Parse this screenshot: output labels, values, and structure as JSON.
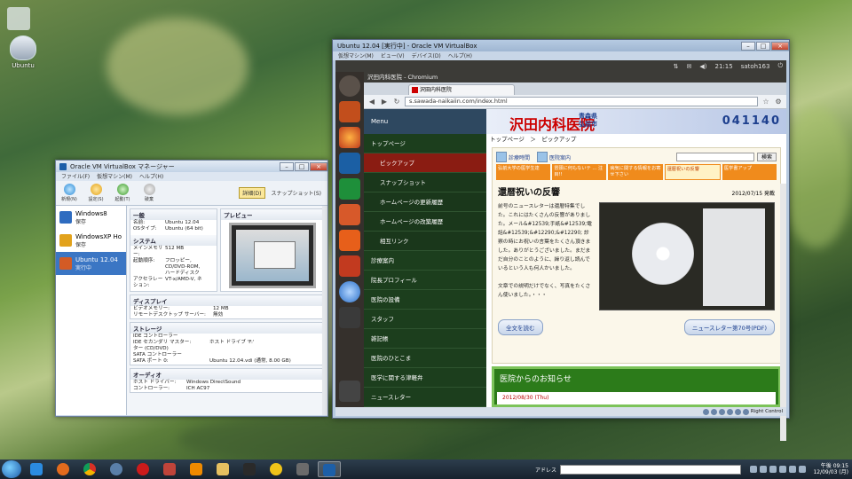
{
  "desktop": {
    "icon_label": "Ubuntu"
  },
  "vbox_manager": {
    "title": "Oracle VM VirtualBox マネージャー",
    "menu": [
      "ファイル(F)",
      "仮想マシン(M)",
      "ヘルプ(H)"
    ],
    "toolbar": {
      "new": "新規(N)",
      "settings": "設定(S)",
      "start": "起動(T)",
      "discard": "破棄",
      "details": "詳細(D)",
      "snapshots": "スナップショット(S)"
    },
    "vms": [
      {
        "name": "Windows8",
        "state": "保存",
        "color": "#2f6cc0"
      },
      {
        "name": "WindowsXP Ho",
        "state": "保存",
        "color": "#e2a21c"
      },
      {
        "name": "Ubuntu 12.04",
        "state": "実行中",
        "color": "#d35b25"
      }
    ],
    "general": {
      "header": "一般",
      "rows": [
        {
          "k": "名前:",
          "v": "Ubuntu 12.04"
        },
        {
          "k": "OSタイプ:",
          "v": "Ubuntu (64 bit)"
        }
      ]
    },
    "preview_header": "プレビュー",
    "system": {
      "header": "システム",
      "rows": [
        {
          "k": "メインメモリー:",
          "v": "512 MB"
        },
        {
          "k": "起動順序:",
          "v": "フロッピー,"
        },
        {
          "k": "",
          "v": "CD/DVD-ROM,"
        },
        {
          "k": "",
          "v": "ハードディスク"
        },
        {
          "k": "アクセラレーション:",
          "v": "VT-x/AMD-V, ネ"
        }
      ]
    },
    "display": {
      "header": "ディスプレイ",
      "rows": [
        {
          "k": "ビデオメモリー:",
          "v": "12 MB"
        },
        {
          "k": "リモートデスクトップ サーバー:",
          "v": "無効"
        }
      ]
    },
    "storage": {
      "header": "ストレージ",
      "rows": [
        {
          "k": "IDE コントローラー",
          "v": ""
        },
        {
          "k": "IDE セカンダリ マスター:",
          "v": "ホスト ドライブ 'F:'"
        },
        {
          "k": "ター (CD/DVD)",
          "v": ""
        },
        {
          "k": "SATA コントローラー",
          "v": ""
        },
        {
          "k": "SATA ポート 0:",
          "v": "Ubuntu 12.04.vdi (通常, 8.00 GB)"
        }
      ]
    },
    "audio": {
      "header": "オーディオ",
      "rows": [
        {
          "k": "ホスト ドライバー:",
          "v": "Windows DirectSound"
        },
        {
          "k": "コントローラー:",
          "v": "ICH AC97"
        }
      ]
    }
  },
  "ubuntu_vm": {
    "title": "Ubuntu 12.04 [実行中] - Oracle VM VirtualBox",
    "menu": [
      "仮想マシン(M)",
      "ビュー(V)",
      "デバイス(D)",
      "ヘルプ(H)"
    ],
    "topbar": {
      "time": "21:15",
      "user": "satoh163"
    },
    "status_label": "Right Control",
    "chrome": {
      "window_title": "沢田内科医院 - Chromium",
      "tab_label": "沢田内科医院",
      "url": "s.sawada-naikaiin.com/index.html"
    },
    "site": {
      "menu_header": "Menu",
      "nav": [
        {
          "label": "トップページ",
          "level": "top"
        },
        {
          "label": "ピックアップ",
          "level": "sub",
          "active": true
        },
        {
          "label": "スナップショット",
          "level": "sub"
        },
        {
          "label": "ホームページの更新履歴",
          "level": "sub"
        },
        {
          "label": "ホームページの改築履歴",
          "level": "sub"
        },
        {
          "label": "相互リンク",
          "level": "sub"
        },
        {
          "label": "診療案内",
          "level": "top"
        },
        {
          "label": "院長プロフィール",
          "level": "top"
        },
        {
          "label": "医院の設備",
          "level": "top"
        },
        {
          "label": "スタッフ",
          "level": "top"
        },
        {
          "label": "雑記帳",
          "level": "top"
        },
        {
          "label": "医院のひとこま",
          "level": "top"
        },
        {
          "label": "医学に関する津軽弁",
          "level": "top"
        },
        {
          "label": "ニュースレター",
          "level": "top"
        }
      ],
      "banner_logo": "沢田内科医院",
      "banner_region": "青森県\n弘前市",
      "banner_code": "041140",
      "breadcrumb": "トップページ　＞　ピックアップ",
      "quick_links": [
        "診療時間",
        "医院案内"
      ],
      "search_button": "検索",
      "orange_tabs": [
        "弘前大学の医学生達",
        "冒頭に何もないテ ... 注目!!",
        "病気に関する情報をお寄せ下さい",
        "還暦祝いの反響",
        "医学書アップ"
      ],
      "article_title": "還暦祝いの反響",
      "article_date": "2012/07/15 発載",
      "article_text": "前号のニュースレターは還暦特集でした。これにはたくさんの反響がありました。メール&#12539;手紙&#12539;電話&#12539;&#12290;&#12290; 診察の時にお祝いの言葉をたくさん頂きました。ありがとうございました。まだまだ自分のことのように、繰り返し読んでいるという人も何人かいました。",
      "article_text2": "文章での説明だけでなく、写真をたくさん使いました。・・・",
      "btn_read": "全文を読む",
      "btn_newsletter": "ニュースレター第70号(PDF)",
      "news_header": "医院からのお知らせ",
      "news_date": "2012/08/30 (Thu)"
    }
  },
  "taskbar": {
    "address_label": "アドレス",
    "time": "午後 09:15",
    "date": "12/09/03 (月)"
  }
}
